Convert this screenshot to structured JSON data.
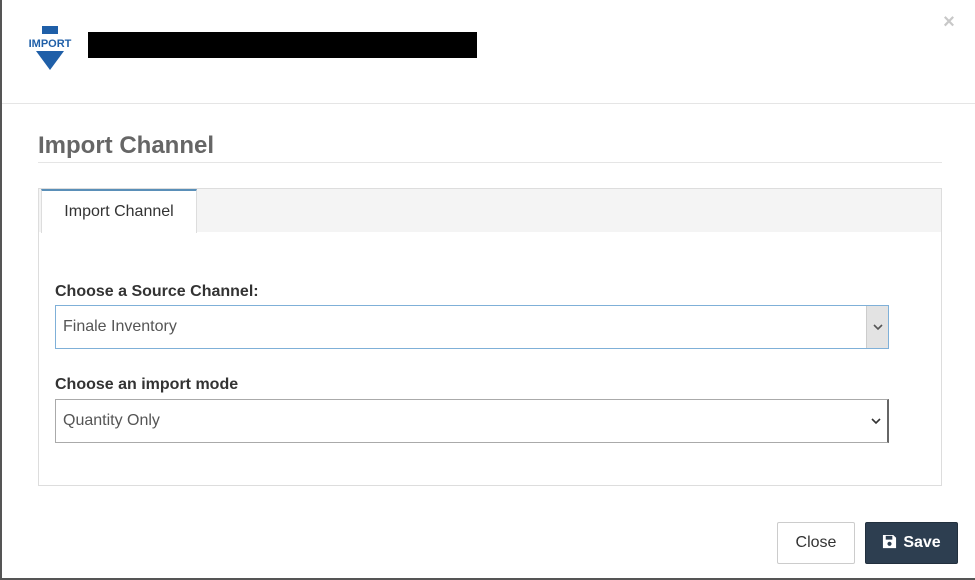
{
  "header": {
    "logo_text": "IMPORT",
    "close_glyph": "×"
  },
  "section": {
    "title": "Import Channel"
  },
  "tabs": [
    {
      "label": "Import Channel",
      "active": true
    }
  ],
  "form": {
    "source_channel": {
      "label": "Choose a Source Channel:",
      "value": "Finale Inventory"
    },
    "import_mode": {
      "label": "Choose an import mode",
      "value": "Quantity Only"
    }
  },
  "footer": {
    "close_label": "Close",
    "save_label": "Save"
  },
  "colors": {
    "logo_blue": "#1f5fa8",
    "save_bg": "#2d3e50",
    "tab_accent": "#5a8fb8"
  },
  "icons": {
    "logo": "import-down-arrow-icon",
    "close": "close-icon",
    "select_arrow": "chevron-down-icon",
    "save": "floppy-disk-icon"
  }
}
